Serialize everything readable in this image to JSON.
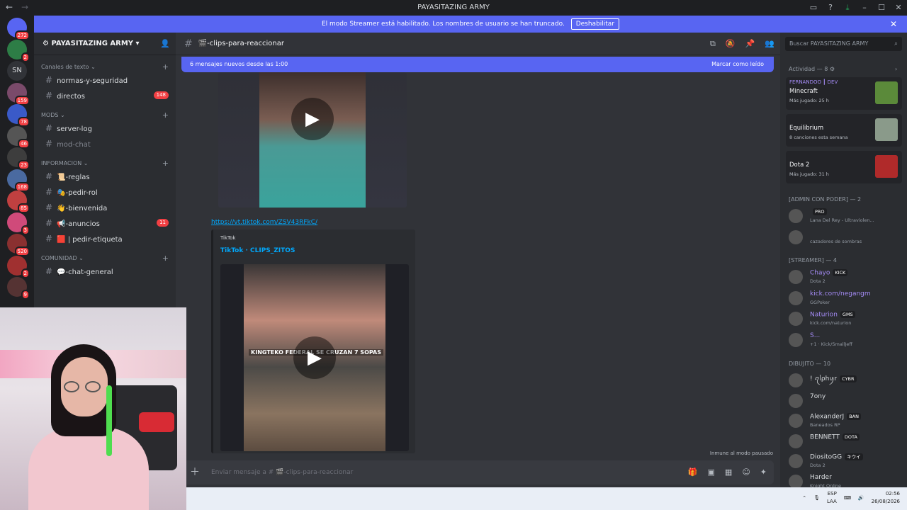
{
  "window": {
    "title": "PAYASITAZING ARMY",
    "back_icon": "arrow-left",
    "forward_icon": "arrow-right"
  },
  "banner": {
    "text": "El modo Streamer está habilitado. Los nombres de usuario se han truncado.",
    "button": "Deshabilitar"
  },
  "servers": [
    {
      "badge": "272",
      "color": "#5865f2"
    },
    {
      "badge": "2",
      "color": "#2d7d46"
    },
    {
      "badge": "",
      "label": "SN",
      "color": "#313338"
    },
    {
      "badge": "159",
      "color": "#7a4a6a"
    },
    {
      "badge": "78",
      "color": "#3a5ac8"
    },
    {
      "badge": "46",
      "color": "#555555"
    },
    {
      "badge": "23",
      "color": "#3d3d3d"
    },
    {
      "badge": "168",
      "color": "#4a6aa0"
    },
    {
      "badge": "85",
      "color": "#c04040"
    },
    {
      "badge": "3",
      "color": "#d04a7a"
    },
    {
      "badge": "520",
      "color": "#8a3030"
    },
    {
      "badge": "2",
      "color": "#a03030"
    },
    {
      "badge": "9",
      "color": "#553333"
    }
  ],
  "server": {
    "name": "PAYASITAZING ARMY"
  },
  "categories": {
    "text": "Canales de texto",
    "mods": "MODS",
    "info": "INFORMACION",
    "community": "COMUNIDAD"
  },
  "channels": {
    "text": [
      {
        "name": "normas-y-seguridad",
        "badge": ""
      },
      {
        "name": "directos",
        "badge": "148"
      }
    ],
    "mods": [
      {
        "name": "server-log",
        "badge": ""
      },
      {
        "name": "mod-chat",
        "badge": ""
      }
    ],
    "info": [
      {
        "name": "📜-reglas",
        "badge": ""
      },
      {
        "name": "🎭-pedir-rol",
        "badge": ""
      },
      {
        "name": "👋-bienvenida",
        "badge": ""
      },
      {
        "name": "📢-anuncios",
        "badge": "11"
      },
      {
        "name": "🟥 | pedir-etiqueta",
        "badge": ""
      }
    ],
    "community": [
      {
        "name": "💬-chat-general",
        "badge": ""
      }
    ]
  },
  "channel_header": {
    "name": "🎬-clips-para-reaccionar"
  },
  "new_messages": {
    "text": "6 mensajes nuevos desde las 1:00",
    "action": "Marcar como leído"
  },
  "message": {
    "link": "https://vt.tiktok.com/ZSV43RFkC/",
    "embed_provider": "TikTok",
    "embed_title": "TikTok · CLIPS_ZITOS",
    "video_caption": "KINGTEKO FEDERAL SE CRUZAN 7 SOPAS"
  },
  "immune_text": "Inmune al modo pausado",
  "composer": {
    "placeholder": "Enviar mensaje a # 🎬-clips-para-reaccionar"
  },
  "search": {
    "placeholder": "Buscar PAYASITAZING ARMY"
  },
  "activity": {
    "header": "Actividad — 8",
    "items": [
      {
        "user": "FERNANDOO ┃ DEV",
        "game": "Minecraft",
        "sub": "Más jugado: 25 h",
        "color": "#5b8a3a"
      },
      {
        "user": "",
        "game": "Equilibrium",
        "sub": "8 canciones esta semana",
        "color": "#8a9a8a"
      },
      {
        "user": "",
        "game": "Dota 2",
        "sub": "Más jugado: 31 h",
        "color": "#b02a2a"
      }
    ]
  },
  "groups": {
    "admin": "[ADMIN CON PODER] — 2",
    "streamer": "[STREAMER] — 4",
    "dibujito": "DIBUJITO — 10"
  },
  "admin_members": [
    {
      "name": "",
      "tag": "PRO",
      "sub": "Lana Del Rey - Ultraviolen..."
    },
    {
      "name": "",
      "tag": "",
      "sub": "cazadores de sombras"
    }
  ],
  "streamer_members": [
    {
      "name": "Chayo",
      "tag": "KICK",
      "sub": "Dota 2"
    },
    {
      "name": "kick.com/negangm",
      "tag": "",
      "sub": "GGPoker"
    },
    {
      "name": "Naturion",
      "tag": "GMS",
      "sub": "kick.com/naturion"
    },
    {
      "name": "S...",
      "tag": "",
      "sub": "+1 · Kick/SmallJeff"
    }
  ],
  "dibujito_members": [
    {
      "name": "! ꪖᥣρhꪗr",
      "tag": "CYBR",
      "sub": ""
    },
    {
      "name": "7ony",
      "tag": "",
      "sub": ""
    },
    {
      "name": "AlexanderJ",
      "tag": "BAN",
      "sub": "Baneados RP"
    },
    {
      "name": "BENNETT",
      "tag": "DOTA",
      "sub": ""
    },
    {
      "name": "DiositoGG",
      "tag": "キウイ",
      "sub": "Dota 2"
    },
    {
      "name": "Harder",
      "tag": "",
      "sub": "Knight Online"
    }
  ],
  "taskbar": {
    "lang": "ESP",
    "layout": "LAA",
    "time": "02:56",
    "date": "26/08/2026"
  }
}
